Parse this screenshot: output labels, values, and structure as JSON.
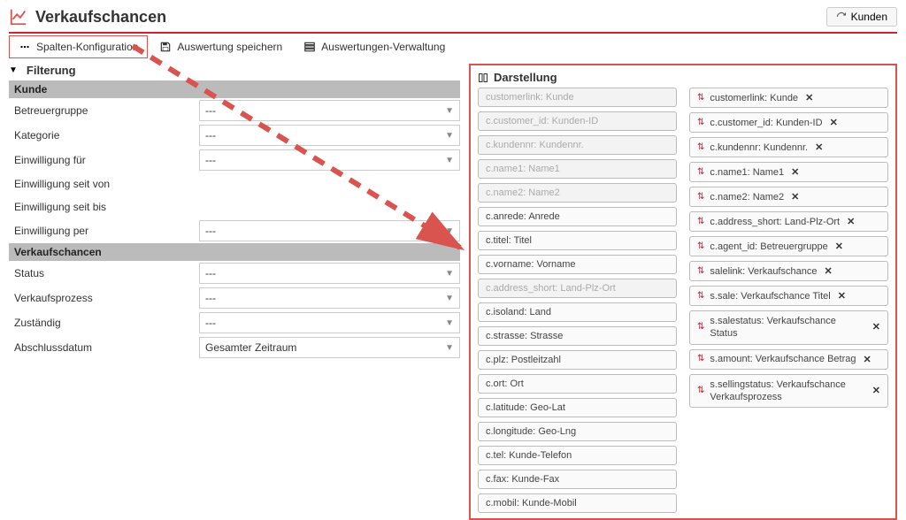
{
  "header": {
    "title": "Verkaufschancen",
    "kunden_label": "Kunden"
  },
  "toolbar": {
    "config": "Spalten-Konfiguration",
    "save": "Auswertung speichern",
    "manage": "Auswertungen-Verwaltung"
  },
  "filter": {
    "title": "Filterung",
    "sections": {
      "kunde": {
        "header": "Kunde",
        "fields": [
          {
            "label": "Betreuergruppe",
            "value": "---"
          },
          {
            "label": "Kategorie",
            "value": "---"
          },
          {
            "label": "Einwilligung für",
            "value": "---"
          },
          {
            "label": "Einwilligung seit von",
            "value": ""
          },
          {
            "label": "Einwilligung seit bis",
            "value": ""
          },
          {
            "label": "Einwilligung per",
            "value": "---"
          }
        ]
      },
      "verkaufschancen": {
        "header": "Verkaufschancen",
        "fields": [
          {
            "label": "Status",
            "value": "---"
          },
          {
            "label": "Verkaufsprozess",
            "value": "---"
          },
          {
            "label": "Zuständig",
            "value": "---"
          },
          {
            "label": "Abschlussdatum",
            "value": "Gesamter Zeitraum"
          }
        ]
      }
    }
  },
  "darstellung": {
    "title": "Darstellung",
    "available": [
      {
        "label": "customerlink: Kunde",
        "disabled": true
      },
      {
        "label": "c.customer_id: Kunden-ID",
        "disabled": true
      },
      {
        "label": "c.kundennr: Kundennr.",
        "disabled": true
      },
      {
        "label": "c.name1: Name1",
        "disabled": true
      },
      {
        "label": "c.name2: Name2",
        "disabled": true
      },
      {
        "label": "c.anrede: Anrede",
        "disabled": false
      },
      {
        "label": "c.titel: Titel",
        "disabled": false
      },
      {
        "label": "c.vorname: Vorname",
        "disabled": false
      },
      {
        "label": "c.address_short: Land-Plz-Ort",
        "disabled": true
      },
      {
        "label": "c.isoland: Land",
        "disabled": false
      },
      {
        "label": "c.strasse: Strasse",
        "disabled": false
      },
      {
        "label": "c.plz: Postleitzahl",
        "disabled": false
      },
      {
        "label": "c.ort: Ort",
        "disabled": false
      },
      {
        "label": "c.latitude: Geo-Lat",
        "disabled": false
      },
      {
        "label": "c.longitude: Geo-Lng",
        "disabled": false
      },
      {
        "label": "c.tel: Kunde-Telefon",
        "disabled": false
      },
      {
        "label": "c.fax: Kunde-Fax",
        "disabled": false
      },
      {
        "label": "c.mobil: Kunde-Mobil",
        "disabled": false
      }
    ],
    "selected": [
      {
        "label": "customerlink: Kunde"
      },
      {
        "label": "c.customer_id: Kunden-ID"
      },
      {
        "label": "c.kundennr: Kundennr."
      },
      {
        "label": "c.name1: Name1"
      },
      {
        "label": "c.name2: Name2"
      },
      {
        "label": "c.address_short: Land-Plz-Ort"
      },
      {
        "label": "c.agent_id: Betreuergruppe"
      },
      {
        "label": "salelink: Verkaufschance"
      },
      {
        "label": "s.sale: Verkaufschance Titel"
      },
      {
        "label": "s.salestatus: Verkaufschance Status"
      },
      {
        "label": "s.amount: Verkaufschance Betrag"
      },
      {
        "label": "s.sellingstatus: Verkaufschance Verkaufsprozess"
      }
    ]
  }
}
